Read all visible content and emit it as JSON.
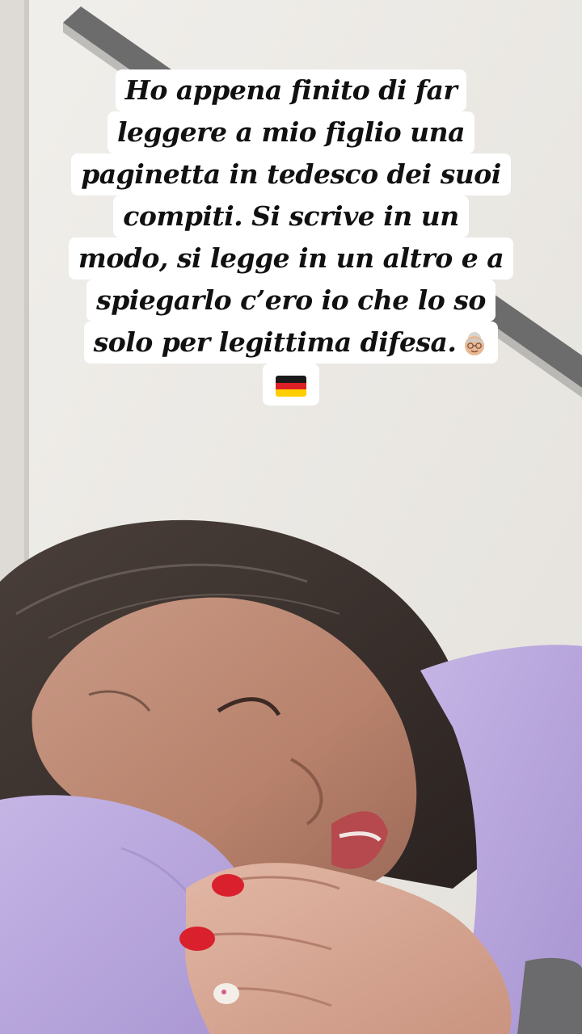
{
  "story": {
    "caption_lines": [
      "Ho appena finito di far",
      "leggere a mio figlio una",
      "paginetta in tedesco dei suoi",
      "compiti. Si scrive in un",
      "modo, si legge in un altro e a",
      "spiegarlo c’ero io che lo so",
      "solo per legittima difesa."
    ],
    "emoji_old_woman": "old-woman-emoji",
    "emoji_flag": "germany-flag-emoji"
  },
  "colors": {
    "caption_bg": "#ffffff",
    "caption_text": "#111111",
    "sweater": "#b9a6dc",
    "nail_polish": "#d9202c"
  }
}
